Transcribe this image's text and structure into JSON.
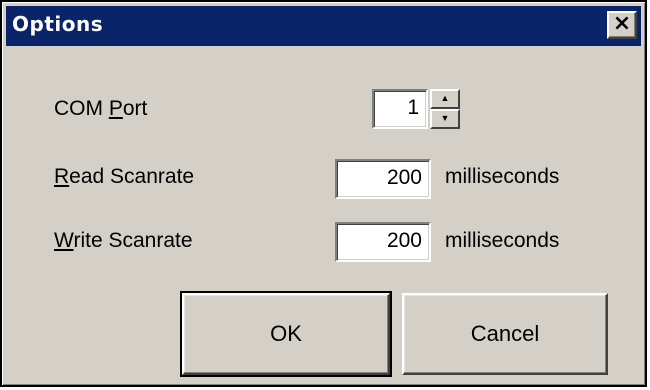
{
  "window": {
    "title": "Options",
    "close_glyph": "×"
  },
  "com_port": {
    "label_mnemonic": "P",
    "label_prefix": "COM ",
    "label_suffix": "ort",
    "value": "1",
    "spin_up_glyph": "▲",
    "spin_down_glyph": "▼"
  },
  "read_scanrate": {
    "label_mnemonic": "R",
    "label_suffix": "ead Scanrate",
    "value": "200",
    "units": "milliseconds"
  },
  "write_scanrate": {
    "label_mnemonic": "W",
    "label_suffix": "rite Scanrate",
    "value": "200",
    "units": "milliseconds"
  },
  "buttons": {
    "ok_label": "OK",
    "cancel_label": "Cancel"
  },
  "colors": {
    "titlebar": "#0a246a",
    "face": "#d4d0c8"
  }
}
